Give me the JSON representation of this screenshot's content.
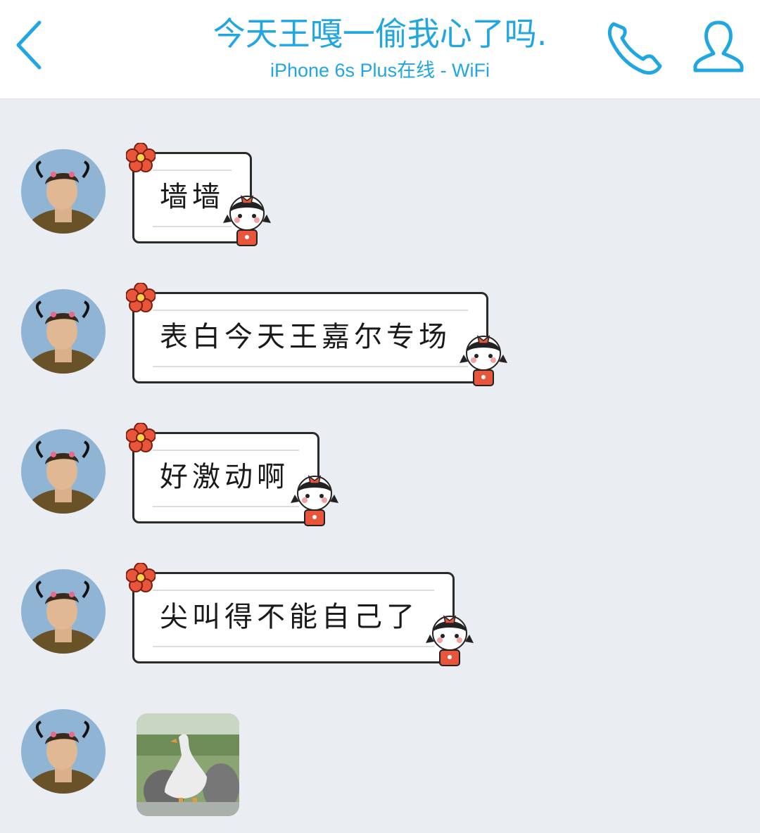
{
  "header": {
    "title": "今天王嘎一偷我心了吗.",
    "subtitle": "iPhone 6s Plus在线 - WiFi",
    "back_icon": "chevron-left-icon",
    "call_icon": "phone-icon",
    "profile_icon": "person-icon",
    "accent_color": "#20a6e0"
  },
  "messages": [
    {
      "type": "text",
      "text": "墙墙"
    },
    {
      "type": "text",
      "text": "表白今天王嘉尔专场"
    },
    {
      "type": "text",
      "text": "好激动啊"
    },
    {
      "type": "text",
      "text": "尖叫得不能自己了"
    },
    {
      "type": "image",
      "description_icon": "goose-photo"
    }
  ],
  "colors": {
    "background": "#eaedf2",
    "bubble_border": "#2a2a2a",
    "flower": "#e8553a",
    "girl_dress": "#e8553a"
  }
}
